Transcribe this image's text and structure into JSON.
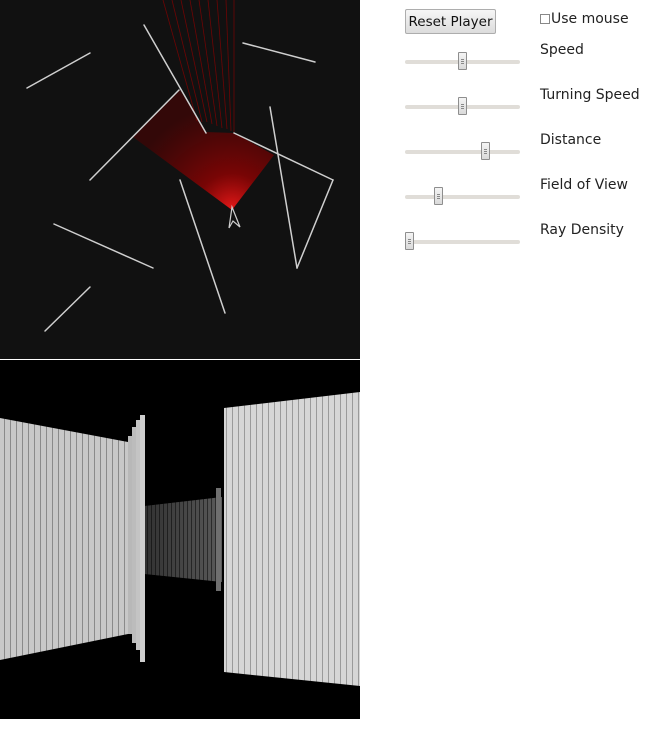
{
  "controls": {
    "reset_label": "Reset Player",
    "use_mouse_label": "Use mouse",
    "use_mouse_checked": false,
    "sliders": [
      {
        "label": "Speed",
        "value": 0.5
      },
      {
        "label": "Turning Speed",
        "value": 0.5
      },
      {
        "label": "Distance",
        "value": 0.72
      },
      {
        "label": "Field of View",
        "value": 0.27
      },
      {
        "label": "Ray Density",
        "value": 0.0
      }
    ]
  },
  "colors": {
    "map_background": "#111111",
    "wall": "#cfcfcf",
    "ray": "#cc0000",
    "view_background": "#000000"
  }
}
